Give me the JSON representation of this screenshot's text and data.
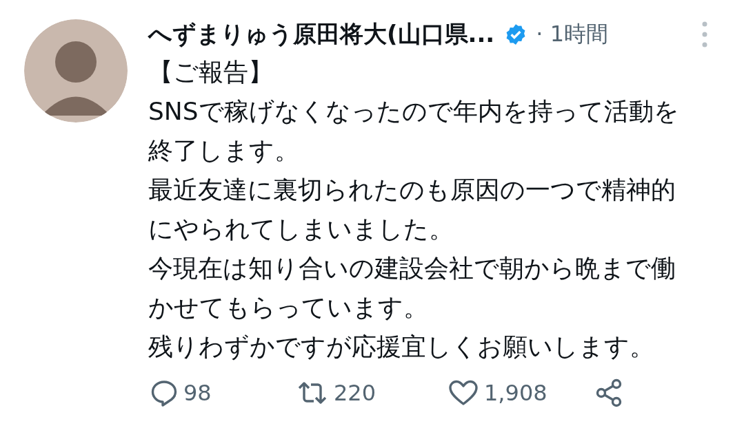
{
  "post": {
    "author": "へずまりゅう原田将大(山口県...",
    "verified": true,
    "time": "· 1時間",
    "text": [
      "【ご報告】",
      "SNSで稼げなくなったので年内を持って活動を終了します。",
      "最近友達に裏切られたのも原因の一つで精神的にやられてしまいました。",
      "今現在は知り合いの建設会社で朝から晩まで働かせてもらっています。",
      "残りわずかですが応援宜しくお願いします。"
    ],
    "actions": [
      {
        "kind": "reply",
        "count": "98"
      },
      {
        "kind": "repost",
        "count": "220"
      },
      {
        "kind": "like",
        "count": "1,908"
      },
      {
        "kind": "share"
      }
    ]
  }
}
